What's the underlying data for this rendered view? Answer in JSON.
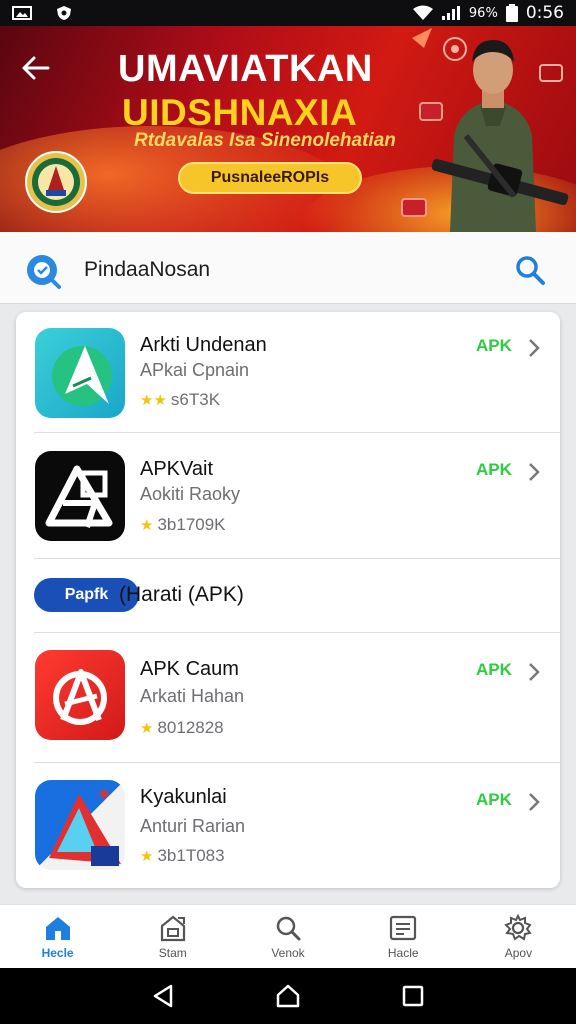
{
  "status_bar": {
    "battery_percent": "96%",
    "time": "0:56"
  },
  "hero": {
    "title_line1": "UMAVIATKAN",
    "title_line2": "UIDSHNAXIA",
    "subtitle": "Rtdavalas Isa Sinenolehatian",
    "button_label": "PusnaleeROPIs",
    "colors": {
      "primary": "#b10d18",
      "accent": "#ffd21e",
      "button": "#f6c52a"
    }
  },
  "search": {
    "text": "PindaaNosan"
  },
  "apps_top": [
    {
      "name": "Arkti Undenan",
      "developer": "APkai Cpnain",
      "stat": "s6T3K",
      "badge": "APK"
    },
    {
      "name": "APKVait",
      "developer": "Aokiti Raoky",
      "stat": "3b1709K",
      "badge": "APK"
    }
  ],
  "section": {
    "pill_label": "Papfk",
    "title": "(Harati  (APK)"
  },
  "apps_bottom": [
    {
      "name": "APK Caum",
      "developer": "Arkati Hahan",
      "stat": "8012828",
      "badge": "APK"
    },
    {
      "name": "Kyakunlai",
      "developer": "Anturi Rarian",
      "stat": "3b1T083",
      "badge": "APK"
    }
  ],
  "bottom_nav": [
    {
      "label": "Hecle",
      "icon": "home-icon"
    },
    {
      "label": "Stam",
      "icon": "store-icon"
    },
    {
      "label": "Venok",
      "icon": "search-icon"
    },
    {
      "label": "Hacle",
      "icon": "list-icon"
    },
    {
      "label": "Apov",
      "icon": "gear-icon"
    }
  ],
  "theme": {
    "apk_color": "#2ecc40",
    "active_nav_color": "#1e7fe0",
    "pill_color": "#1a4fb8"
  }
}
